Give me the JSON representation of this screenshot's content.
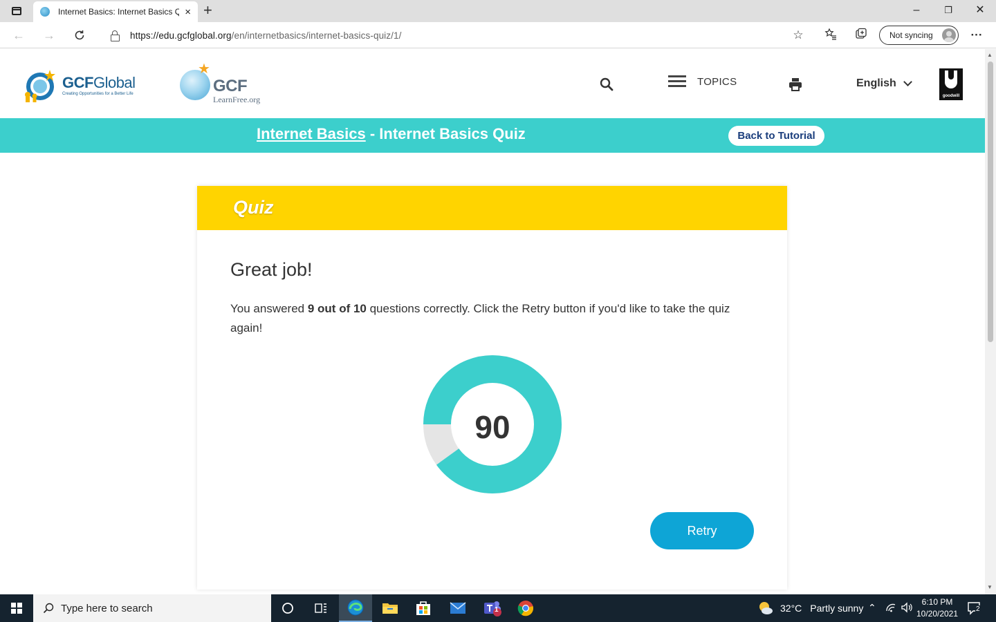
{
  "browser": {
    "tab_title": "Internet Basics: Internet Basics Q",
    "tab_close": "×",
    "new_tab": "+",
    "url_host": "https://edu.gcfglobal.org",
    "url_path": "/en/internetbasics/internet-basics-quiz/1/",
    "sync_label": "Not syncing",
    "minimize": "–",
    "restore": "❐",
    "close": "✕",
    "more": "···"
  },
  "header": {
    "logo_gcf_name_bold": "GCF",
    "logo_gcf_name_rest": "Global",
    "logo_gcf_tagline": "Creating Opportunities for a Better Life",
    "logo_lf_name": "GCF",
    "logo_lf_sub": "LearnFree.org",
    "topics_label": "TOPICS",
    "language": "English",
    "goodwill_label": "goodwill"
  },
  "banner": {
    "tutorial_link": "Internet Basics",
    "separator": " - ",
    "page_title": "Internet Basics Quiz",
    "back_button": "Back to Tutorial"
  },
  "quiz": {
    "header": "Quiz",
    "heading": "Great job!",
    "text_before": "You answered ",
    "text_score": "9 out of 10",
    "text_after": " questions correctly. Click the Retry button if you'd like to take the quiz again!",
    "score": "90",
    "score_fraction": 0.9,
    "retry_button": "Retry",
    "colors": {
      "correct": "#3ccfcc",
      "incorrect": "#e5e5e5",
      "header": "#ffd400",
      "button": "#0ea5d6"
    }
  },
  "taskbar": {
    "search_placeholder": "Type here to search",
    "weather_temp": "32°C",
    "weather_desc": "Partly sunny",
    "time": "6:10 PM",
    "date": "10/20/2021",
    "teams_badge": "1",
    "notification_count": "2"
  }
}
